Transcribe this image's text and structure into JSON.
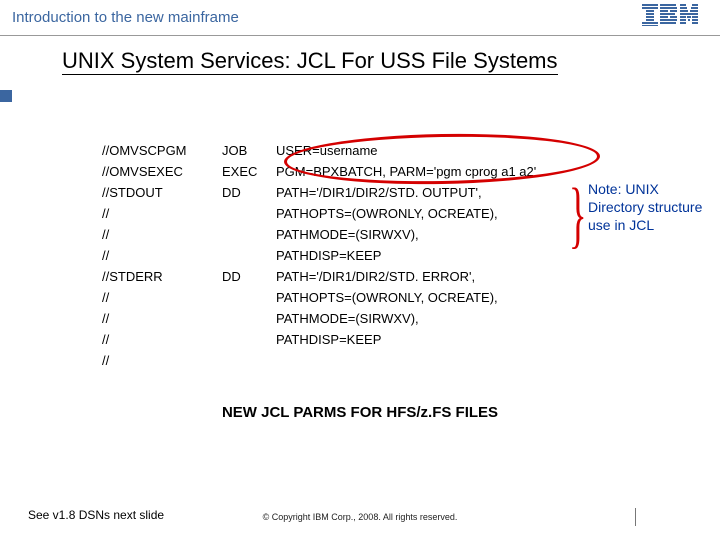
{
  "header": {
    "title": "Introduction to the new mainframe",
    "logo_alt": "IBM"
  },
  "slide_title": "UNIX System Services: JCL For USS File Systems",
  "jcl": [
    {
      "label": "//OMVSCPGM",
      "op": "JOB",
      "text": "USER=username"
    },
    {
      "label": "//OMVSEXEC",
      "op": "EXEC",
      "text": "PGM=BPXBATCH, PARM='pgm cprog a1 a2'"
    },
    {
      "label": "//STDOUT",
      "op": "DD",
      "text": "PATH='/DIR1/DIR2/STD. OUTPUT',"
    },
    {
      "label": "//",
      "op": "",
      "text": "PATHOPTS=(OWRONLY, OCREATE),"
    },
    {
      "label": "//",
      "op": "",
      "text": "PATHMODE=(SIRWXV),"
    },
    {
      "label": "//",
      "op": "",
      "text": "PATHDISP=KEEP"
    },
    {
      "label": "//STDERR",
      "op": "DD",
      "text": "PATH='/DIR1/DIR2/STD. ERROR',"
    },
    {
      "label": "//",
      "op": "",
      "text": "PATHOPTS=(OWRONLY, OCREATE),"
    },
    {
      "label": "//",
      "op": "",
      "text": "PATHMODE=(SIRWXV),"
    },
    {
      "label": "//",
      "op": "",
      "text": "PATHDISP=KEEP"
    },
    {
      "label": "//",
      "op": "",
      "text": ""
    }
  ],
  "annotation_note": "Note: UNIX Directory structure use in JCL",
  "subhead": "NEW JCL PARMS FOR HFS/z.FS FILES",
  "footnote_left": "See v1.8 DSNs next slide",
  "copyright": "© Copyright IBM Corp., 2008. All rights reserved."
}
